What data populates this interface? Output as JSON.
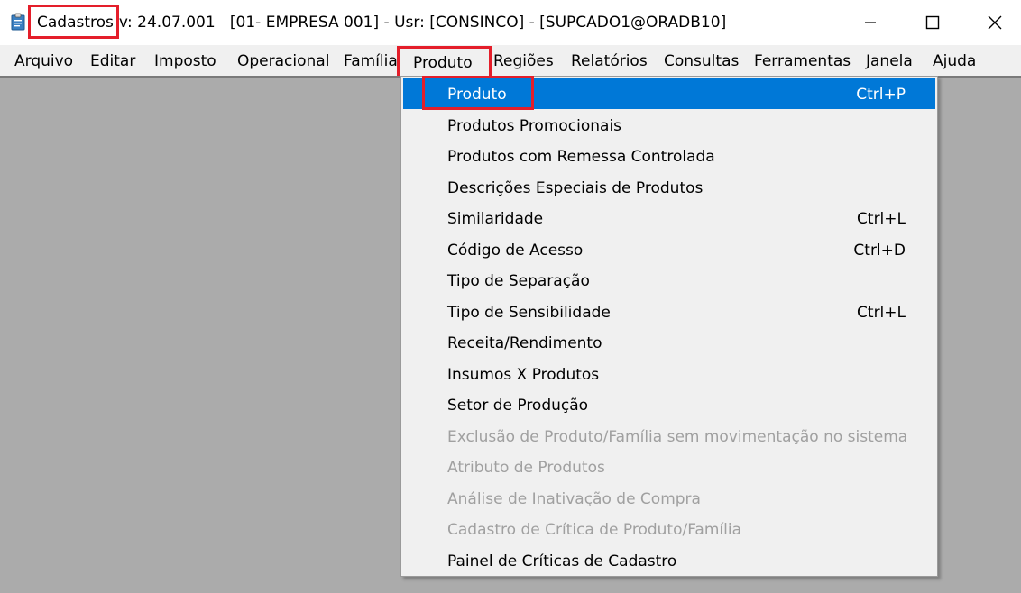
{
  "window": {
    "app_name": "Cadastros",
    "title_rest": "v: 24.07.001   [01- EMPRESA 001] - Usr: [CONSINCO] - [SUPCADO1@ORADB10]",
    "icon": "clipboard-icon",
    "controls": [
      "minimize-icon",
      "maximize-icon",
      "close-icon"
    ]
  },
  "menubar": {
    "items": [
      {
        "label": "Arquivo"
      },
      {
        "label": "Editar"
      },
      {
        "label": "Imposto"
      },
      {
        "label": "Operacional"
      },
      {
        "label": "Família"
      },
      {
        "label": "Produto"
      },
      {
        "label": "Regiões"
      },
      {
        "label": "Relatórios"
      },
      {
        "label": "Consultas"
      },
      {
        "label": "Ferramentas"
      },
      {
        "label": "Janela"
      },
      {
        "label": "Ajuda"
      }
    ]
  },
  "dropdown": {
    "items": [
      {
        "label": "Produto",
        "shortcut": "Ctrl+P",
        "state": "highlighted"
      },
      {
        "label": "Produtos Promocionais",
        "shortcut": ""
      },
      {
        "label": "Produtos com Remessa Controlada",
        "shortcut": ""
      },
      {
        "label": "Descrições Especiais de Produtos",
        "shortcut": ""
      },
      {
        "label": "Similaridade",
        "shortcut": "Ctrl+L"
      },
      {
        "label": "Código de Acesso",
        "shortcut": "Ctrl+D"
      },
      {
        "label": "Tipo de Separação",
        "shortcut": ""
      },
      {
        "label": "Tipo de Sensibilidade",
        "shortcut": "Ctrl+L"
      },
      {
        "label": "Receita/Rendimento",
        "shortcut": ""
      },
      {
        "label": "Insumos X Produtos",
        "shortcut": ""
      },
      {
        "label": "Setor de Produção",
        "shortcut": ""
      },
      {
        "label": "Exclusão de Produto/Família sem movimentação no sistema",
        "shortcut": "",
        "state": "disabled"
      },
      {
        "label": "Atributo de Produtos",
        "shortcut": "",
        "state": "disabled"
      },
      {
        "label": "Análise de Inativação de Compra",
        "shortcut": "",
        "state": "disabled"
      },
      {
        "label": "Cadastro de Crítica de Produto/Família",
        "shortcut": "",
        "state": "disabled"
      },
      {
        "label": "Painel de Críticas de Cadastro",
        "shortcut": ""
      }
    ]
  },
  "colors": {
    "highlight": "#0078d7",
    "annotation_box": "#e41e2a",
    "workspace": "#ababab"
  }
}
